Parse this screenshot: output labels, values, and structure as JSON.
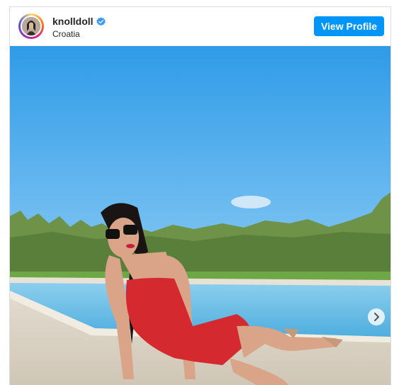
{
  "post": {
    "username": "knolldoll",
    "verified": true,
    "location": "Croatia",
    "view_profile_label": "View Profile"
  },
  "icons": {
    "verified": "verified-badge-icon",
    "next": "chevron-right-icon"
  },
  "colors": {
    "button": "#0095f6",
    "verified": "#3897f0",
    "dress": "#d42a2f"
  }
}
